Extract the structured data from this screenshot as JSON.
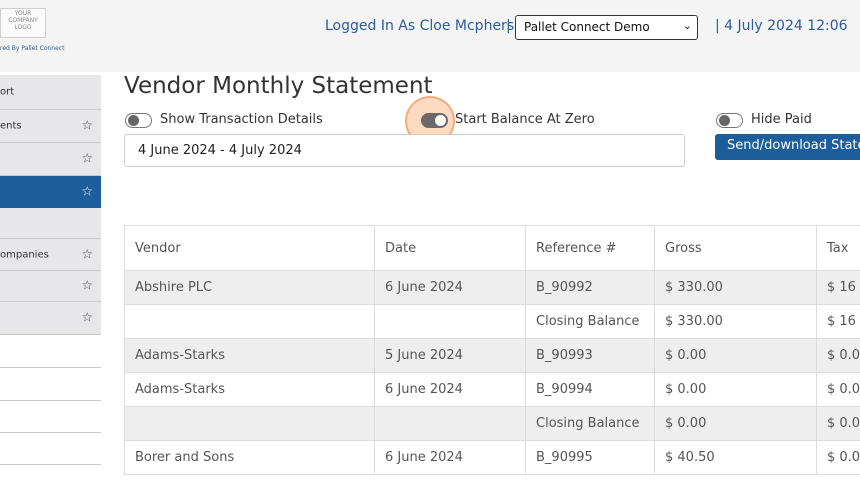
{
  "header": {
    "logo_lines": [
      "YOUR",
      "COMPANY",
      "LOGO"
    ],
    "powered_by": "red By Pallet Connect",
    "logged_in": "Logged In As Cloe Mcpherson",
    "separator": "|",
    "company_select": "Pallet Connect Demo",
    "datetime": "| 4 July 2024 12:06"
  },
  "sidebar": {
    "items": [
      {
        "label": "ort",
        "star": false
      },
      {
        "label": "ents",
        "star": true
      },
      {
        "label": "",
        "star": true
      },
      {
        "label": "",
        "star": true,
        "active": true
      },
      {
        "label": "",
        "star": false
      },
      {
        "label": "ompanies",
        "star": true
      },
      {
        "label": "",
        "star": true
      },
      {
        "label": "",
        "star": true
      },
      {
        "label": "",
        "star": false
      },
      {
        "label": "",
        "star": false
      },
      {
        "label": "",
        "star": false
      },
      {
        "label": "",
        "star": false
      }
    ]
  },
  "page": {
    "title": "Vendor Monthly Statement",
    "toggles": {
      "show_details": {
        "label": "Show Transaction Details",
        "on": false
      },
      "start_zero": {
        "label": "Start Balance At Zero",
        "on": true
      },
      "hide_paid": {
        "label": "Hide Paid",
        "on": false
      }
    },
    "date_range": "4 June 2024 - 4 July 2024",
    "send_button": "Send/download Statements"
  },
  "table": {
    "columns": [
      "Vendor",
      "Date",
      "Reference #",
      "Gross",
      "Tax"
    ],
    "rows": [
      [
        "Abshire PLC",
        "6 June 2024",
        "B_90992",
        "$ 330.00",
        "$ 16"
      ],
      [
        "",
        "",
        "Closing Balance",
        "$ 330.00",
        "$ 16"
      ],
      [
        "Adams-Starks",
        "5 June 2024",
        "B_90993",
        "$ 0.00",
        "$ 0.0"
      ],
      [
        "Adams-Starks",
        "6 June 2024",
        "B_90994",
        "$ 0.00",
        "$ 0.0"
      ],
      [
        "",
        "",
        "Closing Balance",
        "$ 0.00",
        "$ 0.0"
      ],
      [
        "Borer and Sons",
        "6 June 2024",
        "B_90995",
        "$ 40.50",
        "$ 0.0"
      ]
    ]
  },
  "colors": {
    "accent": "#1c5d9c",
    "link": "#2b5c9c",
    "halo": "#f5a36a"
  },
  "icons": {
    "star": "star-outline-icon",
    "chevron": "chevron-down-icon",
    "toggle": "toggle-switch"
  }
}
